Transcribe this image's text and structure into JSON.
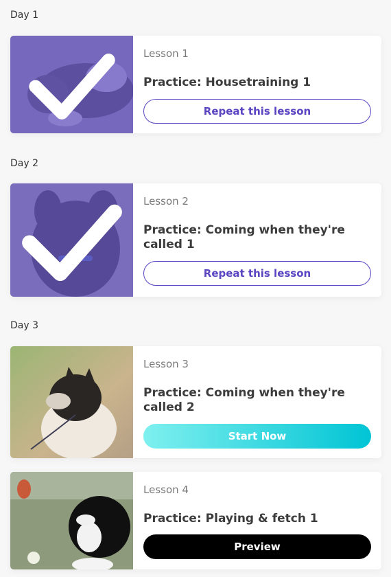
{
  "days": [
    {
      "label": "Day 1"
    },
    {
      "label": "Day 2"
    },
    {
      "label": "Day 3"
    }
  ],
  "lessons": [
    {
      "number": "Lesson 1",
      "title": "Practice: Housetraining 1",
      "button": "Repeat this lesson",
      "completed": true
    },
    {
      "number": "Lesson 2",
      "title": "Practice: Coming when they're called 1",
      "button": "Repeat this lesson",
      "completed": true
    },
    {
      "number": "Lesson 3",
      "title": "Practice: Coming when they're called 2",
      "button": "Start Now",
      "completed": false
    },
    {
      "number": "Lesson 4",
      "title": "Practice: Playing & fetch 1",
      "button": "Preview",
      "completed": false
    }
  ],
  "colors": {
    "accent": "#5b45c2",
    "completed_overlay": "#6e5cc8",
    "start_gradient_from": "#7ff0ef",
    "start_gradient_to": "#00c4d4",
    "preview_button": "#000000"
  },
  "icons": {
    "completed": "checkmark-icon"
  }
}
